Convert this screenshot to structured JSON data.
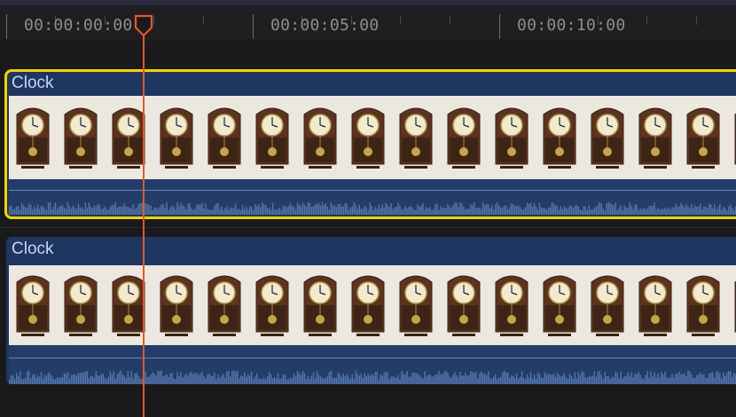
{
  "ruler": {
    "timecodes": [
      "00:00:00:00",
      "00:00:05:00",
      "00:00:10:00"
    ]
  },
  "clips": [
    {
      "title": "Clock",
      "selected": true
    },
    {
      "title": "Clock",
      "selected": false
    }
  ],
  "colors": {
    "selection": "#f5d300",
    "playhead": "#e2582c",
    "clip_header": "#1f3660",
    "audio": "#233d68"
  },
  "icons": {
    "playhead": "playhead-marker-icon",
    "frame": "wall-clock-thumbnail"
  }
}
